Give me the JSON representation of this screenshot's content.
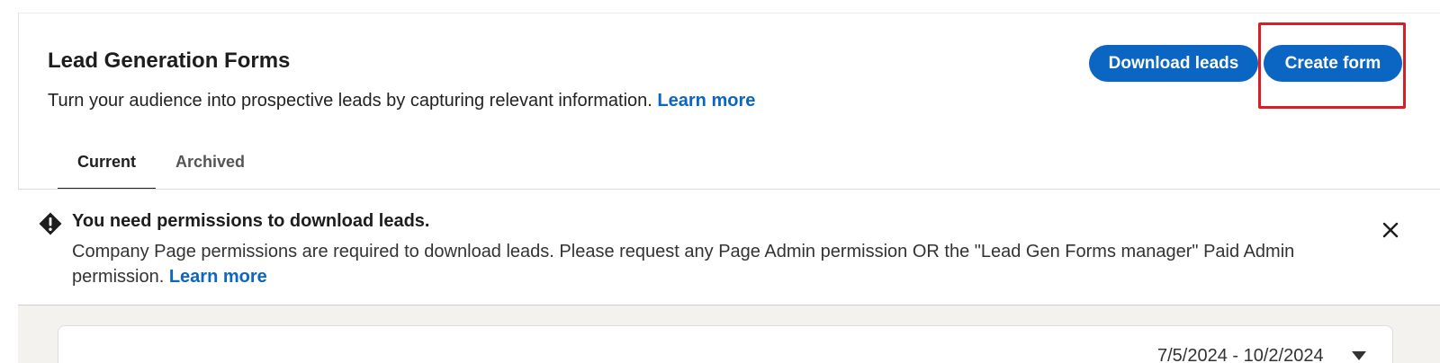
{
  "header": {
    "title": "Lead Generation Forms",
    "description": "Turn your audience into prospective leads by capturing relevant information.",
    "learn_more": "Learn more"
  },
  "actions": {
    "download_leads": "Download leads",
    "create_form": "Create form"
  },
  "tabs": [
    {
      "label": "Current",
      "active": true
    },
    {
      "label": "Archived",
      "active": false
    }
  ],
  "alert": {
    "title": "You need permissions to download leads.",
    "body": "Company Page permissions are required to download leads. Please request any Page Admin permission OR the \"Lead Gen Forms manager\" Paid Admin permission.",
    "learn_more": "Learn more",
    "icon": "warning-diamond-icon",
    "close_icon": "close-icon"
  },
  "filter": {
    "date_range": "7/5/2024 - 10/2/2024"
  },
  "colors": {
    "primary": "#0a66c2",
    "highlight": "#d91f26",
    "page_background": "#f3f2ef"
  }
}
